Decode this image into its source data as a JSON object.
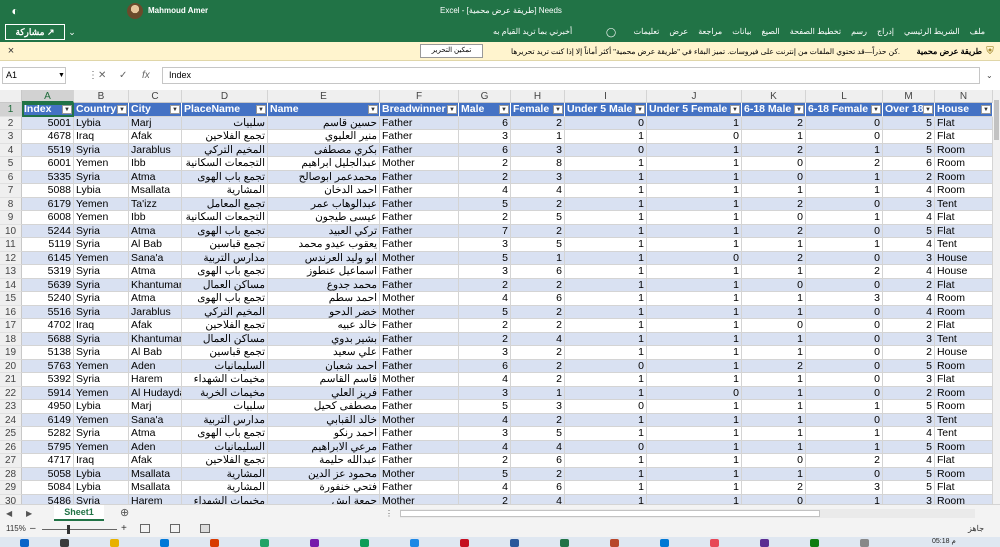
{
  "titlebar": {
    "user_name": "Mahmoud Amer",
    "doc_title": "Excel - [طريقة عرض محمية] Needs"
  },
  "ribbon": {
    "share_label": "مشاركة",
    "tabs": [
      "ملف",
      "الشريط الرئيسي",
      "إدراج",
      "رسم",
      "تخطيط الصفحة",
      "الصيغ",
      "بيانات",
      "مراجعة",
      "عرض",
      "تعليمات"
    ],
    "tell_me": "أخبرني بما تريد القيام به"
  },
  "protected_view": {
    "title": "طريقة عرض محمية",
    "message": "كن حذراً—قد تحتوي الملفات من إنترنت على فيروسات. تميز البقاء في \"طريقة عرض محمية\" أكثر أماناً إلا إذا كنت تريد تحريرها.",
    "enable_button": "تمكين التحرير"
  },
  "formula_bar": {
    "name_box": "A1",
    "content": "Index"
  },
  "columns": {
    "letters": [
      "A",
      "B",
      "C",
      "D",
      "E",
      "F",
      "G",
      "H",
      "I",
      "J",
      "K",
      "L",
      "M",
      "N"
    ],
    "headers": [
      "Index",
      "Country",
      "City",
      "PlaceName",
      "Name",
      "Breadwinner",
      "Male",
      "Female",
      "Under 5 Male",
      "Under 5 Female",
      "6-18 Male",
      "6-18 Female",
      "Over 18",
      "House"
    ]
  },
  "rows": [
    {
      "n": 2,
      "v": [
        "5001",
        "Lybia",
        "Marj",
        "سلبيات",
        "حسين قاسم",
        "Father",
        "6",
        "2",
        "0",
        "1",
        "2",
        "0",
        "5",
        "Flat"
      ]
    },
    {
      "n": 3,
      "v": [
        "4678",
        "Iraq",
        "Afak",
        "تجمع الفلاحين",
        "منير العليوي",
        "Father",
        "3",
        "1",
        "1",
        "0",
        "1",
        "0",
        "2",
        "Flat"
      ]
    },
    {
      "n": 4,
      "v": [
        "5519",
        "Syria",
        "Jarablus",
        "المخيم التركي",
        "بكري مصطفى",
        "Father",
        "6",
        "3",
        "0",
        "1",
        "2",
        "1",
        "5",
        "Room"
      ]
    },
    {
      "n": 5,
      "v": [
        "6001",
        "Yemen",
        "Ibb",
        "التجمعات السكانية",
        "عبدالجليل ابراهيم",
        "Mother",
        "2",
        "8",
        "1",
        "1",
        "0",
        "2",
        "6",
        "Room"
      ]
    },
    {
      "n": 6,
      "v": [
        "5335",
        "Syria",
        "Atma",
        "تجمع باب الهوى",
        "محمدعمر ابوصالح",
        "Father",
        "2",
        "3",
        "1",
        "1",
        "0",
        "1",
        "2",
        "Room"
      ]
    },
    {
      "n": 7,
      "v": [
        "5088",
        "Lybia",
        "Msallata",
        "المشارية",
        "احمد الدخان",
        "Father",
        "4",
        "4",
        "1",
        "1",
        "1",
        "1",
        "4",
        "Room"
      ]
    },
    {
      "n": 8,
      "v": [
        "6179",
        "Yemen",
        "Ta'izz",
        "تجمع المعامل",
        "عبدالوهاب عمر",
        "Father",
        "5",
        "2",
        "1",
        "1",
        "2",
        "0",
        "3",
        "Tent"
      ]
    },
    {
      "n": 9,
      "v": [
        "6008",
        "Yemen",
        "Ibb",
        "التجمعات السكانية",
        "عيسى طيجون",
        "Father",
        "2",
        "5",
        "1",
        "1",
        "0",
        "1",
        "4",
        "Flat"
      ]
    },
    {
      "n": 10,
      "v": [
        "5244",
        "Syria",
        "Atma",
        "تجمع باب الهوى",
        "تركي العبيد",
        "Father",
        "7",
        "2",
        "1",
        "1",
        "2",
        "0",
        "5",
        "Flat"
      ]
    },
    {
      "n": 11,
      "v": [
        "5119",
        "Syria",
        "Al Bab",
        "تجمع قباسين",
        "يعقوب عيدو محمد",
        "Father",
        "3",
        "5",
        "1",
        "1",
        "1",
        "1",
        "4",
        "Tent"
      ]
    },
    {
      "n": 12,
      "v": [
        "6145",
        "Yemen",
        "Sana'a",
        "مدارس التربية",
        "ابو وليد العرندس",
        "Mother",
        "5",
        "1",
        "1",
        "0",
        "2",
        "0",
        "3",
        "House"
      ]
    },
    {
      "n": 13,
      "v": [
        "5319",
        "Syria",
        "Atma",
        "تجمع باب الهوى",
        "اسماعيل عنطوز",
        "Father",
        "3",
        "6",
        "1",
        "1",
        "1",
        "2",
        "4",
        "House"
      ]
    },
    {
      "n": 14,
      "v": [
        "5639",
        "Syria",
        "Khantuman",
        "مساكن العمال",
        "محمد جدوع",
        "Father",
        "2",
        "2",
        "1",
        "1",
        "0",
        "0",
        "2",
        "Flat"
      ]
    },
    {
      "n": 15,
      "v": [
        "5240",
        "Syria",
        "Atma",
        "تجمع باب الهوى",
        "احمد سطم",
        "Mother",
        "4",
        "6",
        "1",
        "1",
        "1",
        "3",
        "4",
        "Room"
      ]
    },
    {
      "n": 16,
      "v": [
        "5516",
        "Syria",
        "Jarablus",
        "المخيم التركي",
        "خضر الدحو",
        "Mother",
        "5",
        "2",
        "1",
        "1",
        "1",
        "0",
        "4",
        "Room"
      ]
    },
    {
      "n": 17,
      "v": [
        "4702",
        "Iraq",
        "Afak",
        "تجمع الفلاحين",
        "خالد عبيه",
        "Father",
        "2",
        "2",
        "1",
        "1",
        "0",
        "0",
        "2",
        "Flat"
      ]
    },
    {
      "n": 18,
      "v": [
        "5688",
        "Syria",
        "Khantuman",
        "مساكن العمال",
        "بشير بدوي",
        "Father",
        "2",
        "4",
        "1",
        "1",
        "1",
        "0",
        "3",
        "Tent"
      ]
    },
    {
      "n": 19,
      "v": [
        "5138",
        "Syria",
        "Al Bab",
        "تجمع قباسين",
        "علي سعيد",
        "Father",
        "3",
        "2",
        "1",
        "1",
        "1",
        "0",
        "2",
        "House"
      ]
    },
    {
      "n": 20,
      "v": [
        "5763",
        "Yemen",
        "Aden",
        "السليمانيات",
        "احمد شعبان",
        "Father",
        "6",
        "2",
        "0",
        "1",
        "2",
        "0",
        "5",
        "Room"
      ]
    },
    {
      "n": 21,
      "v": [
        "5392",
        "Syria",
        "Harem",
        "مخيمات الشهداء",
        "قاسم القاسم",
        "Mother",
        "4",
        "2",
        "1",
        "1",
        "1",
        "0",
        "3",
        "Flat"
      ]
    },
    {
      "n": 22,
      "v": [
        "5914",
        "Yemen",
        "Al Hudaydah",
        "مخيمات الخربة",
        "فريز العلي",
        "Father",
        "3",
        "1",
        "1",
        "0",
        "1",
        "0",
        "2",
        "Room"
      ]
    },
    {
      "n": 23,
      "v": [
        "4950",
        "Lybia",
        "Marj",
        "سلبيات",
        "مصطفى كحيل",
        "Father",
        "5",
        "3",
        "0",
        "1",
        "1",
        "1",
        "5",
        "Room"
      ]
    },
    {
      "n": 24,
      "v": [
        "6149",
        "Yemen",
        "Sana'a",
        "مدارس التربية",
        "خالد القبابي",
        "Mother",
        "4",
        "2",
        "1",
        "1",
        "1",
        "0",
        "3",
        "Tent"
      ]
    },
    {
      "n": 25,
      "v": [
        "5282",
        "Syria",
        "Atma",
        "تجمع باب الهوى",
        "احمد رنكو",
        "Father",
        "3",
        "5",
        "1",
        "1",
        "1",
        "1",
        "4",
        "Tent"
      ]
    },
    {
      "n": 26,
      "v": [
        "5795",
        "Yemen",
        "Aden",
        "السليمانيات",
        "مرعي الابراهيم",
        "Father",
        "4",
        "4",
        "0",
        "1",
        "1",
        "1",
        "5",
        "Room"
      ]
    },
    {
      "n": 27,
      "v": [
        "4717",
        "Iraq",
        "Afak",
        "تجمع الفلاحين",
        "عبدالله حليمة",
        "Father",
        "2",
        "6",
        "1",
        "1",
        "0",
        "2",
        "4",
        "Flat"
      ]
    },
    {
      "n": 28,
      "v": [
        "5058",
        "Lybia",
        "Msallata",
        "المشارية",
        "محمود عز الدين",
        "Mother",
        "5",
        "2",
        "1",
        "1",
        "1",
        "0",
        "5",
        "Room"
      ]
    },
    {
      "n": 29,
      "v": [
        "5084",
        "Lybia",
        "Msallata",
        "المشارية",
        "فتحي خنفورة",
        "Father",
        "4",
        "6",
        "1",
        "1",
        "2",
        "3",
        "5",
        "Flat"
      ]
    },
    {
      "n": 30,
      "v": [
        "5486",
        "Syria",
        "Harem",
        "مخيمات الشهداء",
        "جمعة ابش",
        "Mother",
        "2",
        "4",
        "1",
        "1",
        "0",
        "1",
        "3",
        "Room"
      ]
    }
  ],
  "sheets": {
    "active": "Sheet1"
  },
  "status": {
    "zoom": "115%",
    "ready": "جاهز"
  },
  "taskbar": {
    "time": "05:18 م"
  }
}
